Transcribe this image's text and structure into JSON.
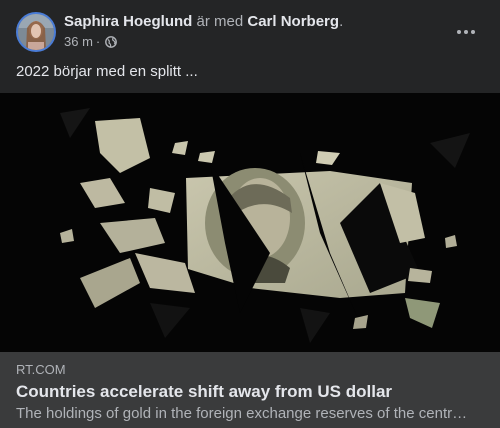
{
  "post": {
    "author": "Saphira Hoeglund",
    "with_text": "är med",
    "tagged": "Carl Norberg",
    "period": ".",
    "time": "36 m",
    "separator": "·",
    "privacy_icon": "globe-icon",
    "more_icon": "more-dots-icon",
    "text": "2022 börjar med en splitt ..."
  },
  "link": {
    "domain": "RT.COM",
    "title": "Countries accelerate shift away from US dollar",
    "description": "The holdings of gold in the foreign exchange reserves of the centr…"
  },
  "colors": {
    "background": "#242526",
    "link_background": "#3a3b3c",
    "primary_text": "#e4e6eb",
    "secondary_text": "#b0b3b8"
  }
}
